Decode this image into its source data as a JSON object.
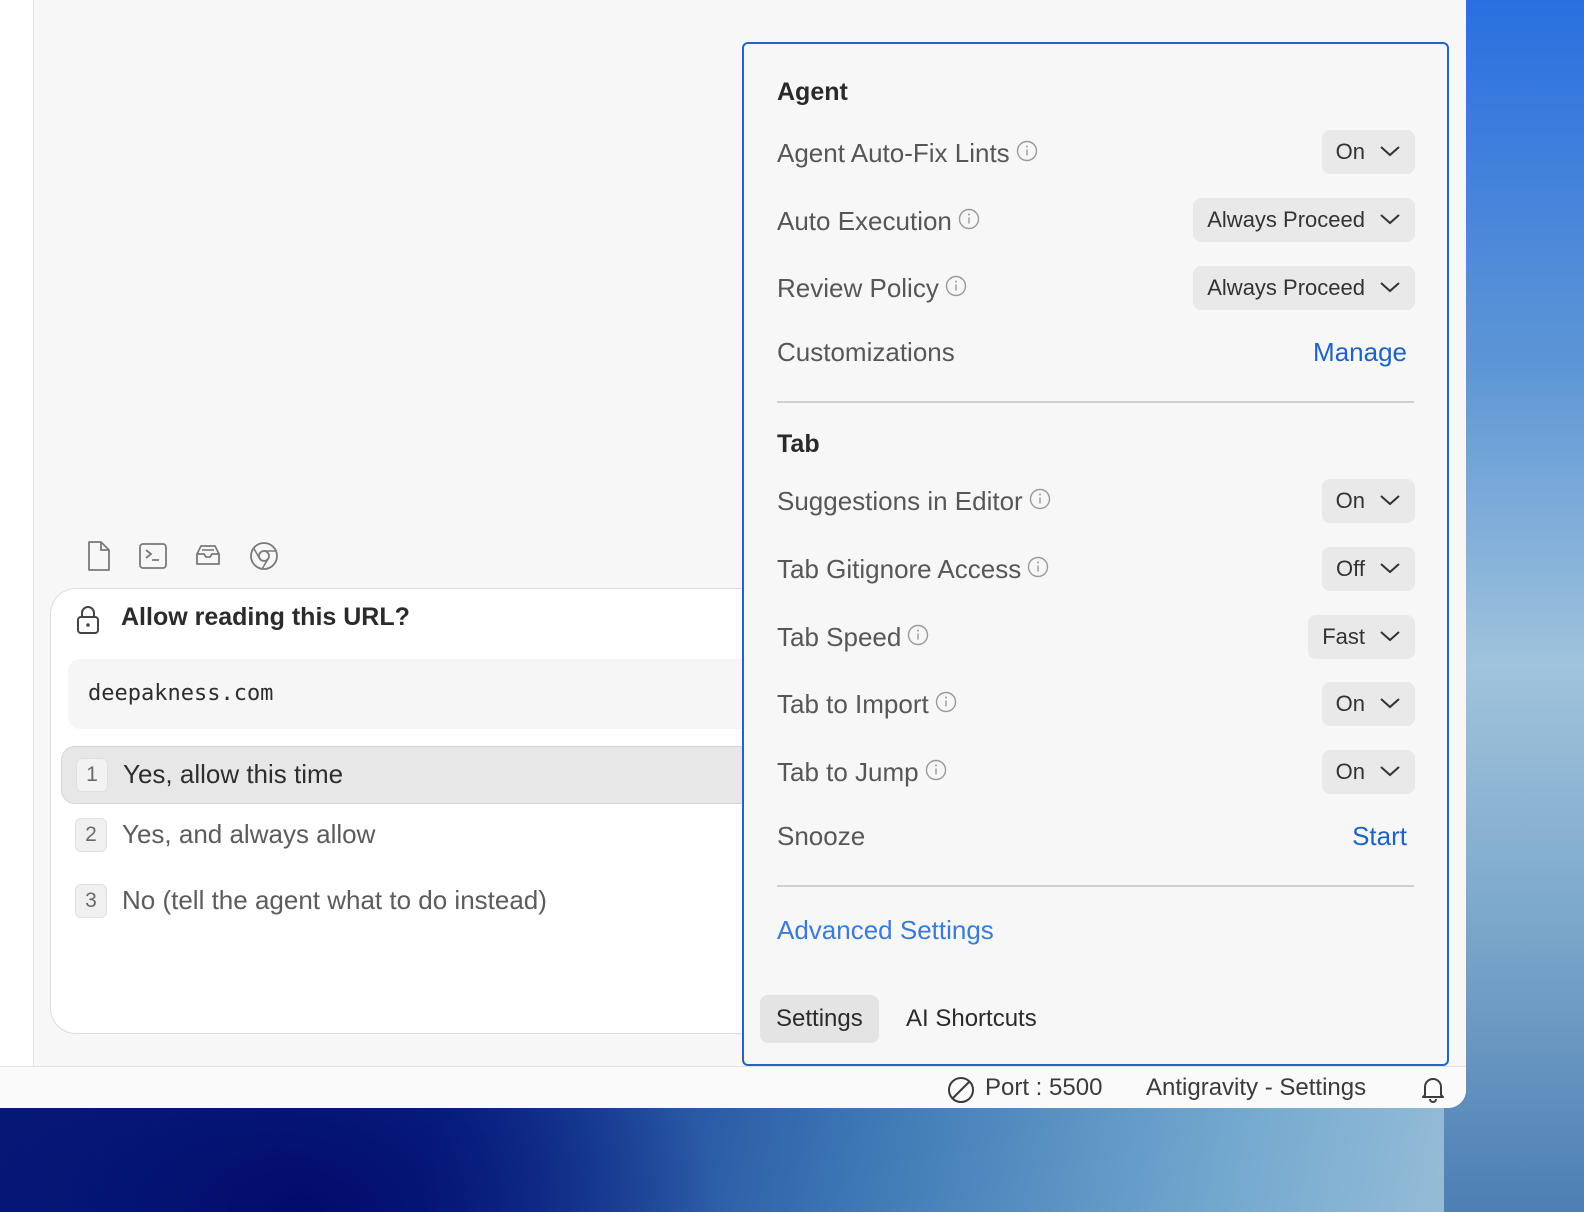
{
  "permission": {
    "title": "Allow reading this URL?",
    "url": "deepakness.com",
    "options": [
      {
        "num": "1",
        "label": "Yes, allow this time"
      },
      {
        "num": "2",
        "label": "Yes, and always allow"
      },
      {
        "num": "3",
        "label": "No (tell the agent what to do instead)"
      }
    ]
  },
  "toolbar_icons": [
    "file-icon",
    "terminal-icon",
    "inbox-icon",
    "chrome-icon"
  ],
  "settings": {
    "agent": {
      "title": "Agent",
      "auto_fix_lints": {
        "label": "Agent Auto-Fix Lints",
        "value": "On"
      },
      "auto_execution": {
        "label": "Auto Execution",
        "value": "Always Proceed"
      },
      "review_policy": {
        "label": "Review Policy",
        "value": "Always Proceed"
      },
      "customizations": {
        "label": "Customizations",
        "action": "Manage"
      }
    },
    "tab": {
      "title": "Tab",
      "suggestions": {
        "label": "Suggestions in Editor",
        "value": "On"
      },
      "gitignore": {
        "label": "Tab Gitignore Access",
        "value": "Off"
      },
      "speed": {
        "label": "Tab Speed",
        "value": "Fast"
      },
      "import": {
        "label": "Tab to Import",
        "value": "On"
      },
      "jump": {
        "label": "Tab to Jump",
        "value": "On"
      },
      "snooze": {
        "label": "Snooze",
        "action": "Start"
      }
    },
    "advanced_link": "Advanced Settings",
    "tabs": {
      "settings": "Settings",
      "shortcuts": "AI Shortcuts"
    }
  },
  "statusbar": {
    "port": "Port : 5500",
    "window_title": "Antigravity - Settings"
  },
  "colors": {
    "accent": "#2166c0",
    "link": "#1f63c2"
  }
}
